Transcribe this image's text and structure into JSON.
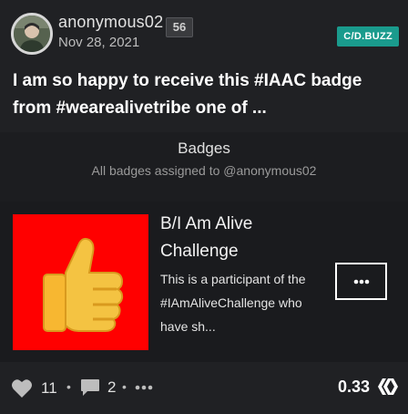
{
  "post": {
    "author": "anonymous02",
    "reputation": "56",
    "date": "Nov 28, 2021",
    "community": "C/D.BUZZ",
    "title": "I am so happy to receive this #IAAC badge from #wearealivetribe one of ..."
  },
  "embed": {
    "heading": "Badges",
    "subheading": "All badges assigned to @anonymous02",
    "badge": {
      "name": "B/I Am Alive Challenge",
      "description": "This is a participant of the #IAmAliveChallenge who have sh...",
      "image_icon": "thumbs-up-emoji",
      "image_bg": "#ff0000"
    },
    "more_icon": "ellipsis-icon"
  },
  "footer": {
    "likes": "11",
    "comments": "2",
    "payout": "0.33",
    "heart_icon": "heart-icon",
    "comment_icon": "comment-icon",
    "more_icon": "more-dots-icon",
    "currency_icon": "hive-logo-icon"
  },
  "colors": {
    "background": "#202124",
    "community_badge": "#1a9b8d",
    "badge_image_bg": "#ff0000"
  }
}
